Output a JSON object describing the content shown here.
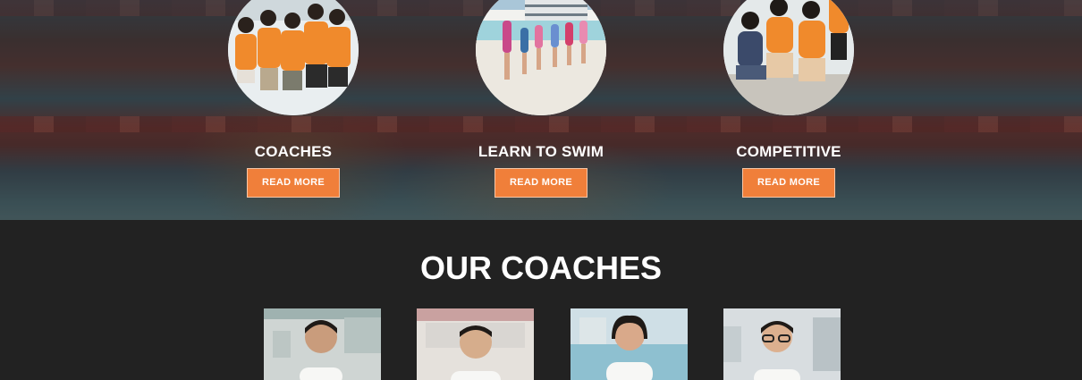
{
  "programs": [
    {
      "title": "COACHES",
      "button": "READ MORE",
      "image": "coaches-group-photo"
    },
    {
      "title": "LEARN TO SWIM",
      "button": "READ MORE",
      "image": "kids-poolside-photo"
    },
    {
      "title": "COMPETITIVE",
      "button": "READ MORE",
      "image": "swimmers-seated-photo"
    }
  ],
  "coaches_section": {
    "title": "OUR COACHES",
    "coaches": [
      {
        "photo": "coach-1-portrait"
      },
      {
        "photo": "coach-2-portrait"
      },
      {
        "photo": "coach-3-portrait"
      },
      {
        "photo": "coach-4-portrait"
      }
    ]
  },
  "colors": {
    "accent": "#f07f3a",
    "dark_bg": "#222222",
    "shirt_orange": "#f08a2c"
  }
}
